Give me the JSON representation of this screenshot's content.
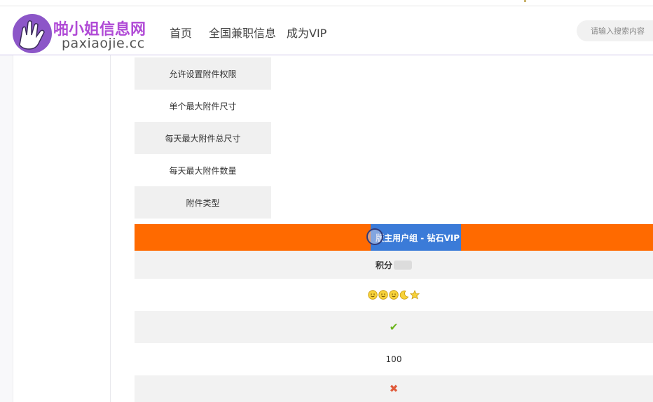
{
  "header": {
    "logo_title": "啪小姐信息网",
    "logo_sub": "paxiaojie.cc",
    "nav": [
      "首页",
      "全国兼职信息",
      "成为VIP"
    ],
    "search_placeholder": "请输入搜索内容"
  },
  "permissions": {
    "labels": [
      "允许设置附件权限",
      "单个最大附件尺寸",
      "每天最大附件总尺寸",
      "每天最大附件数量",
      "附件类型"
    ]
  },
  "group": {
    "title": "版主用户组 - 钻石VIP",
    "points_label": "积分",
    "level_icons": [
      "sun-icon",
      "sun-icon",
      "sun-icon",
      "moon-icon",
      "star-icon"
    ],
    "allow_value": "check",
    "count_value": "100",
    "deny_value": "cross"
  },
  "colors": {
    "group_bar": "#ff6a00",
    "group_title_bg": "#3b7bd8",
    "check": "#6bb51c",
    "cross": "#e05a3a",
    "brand": "#8c56c8"
  }
}
